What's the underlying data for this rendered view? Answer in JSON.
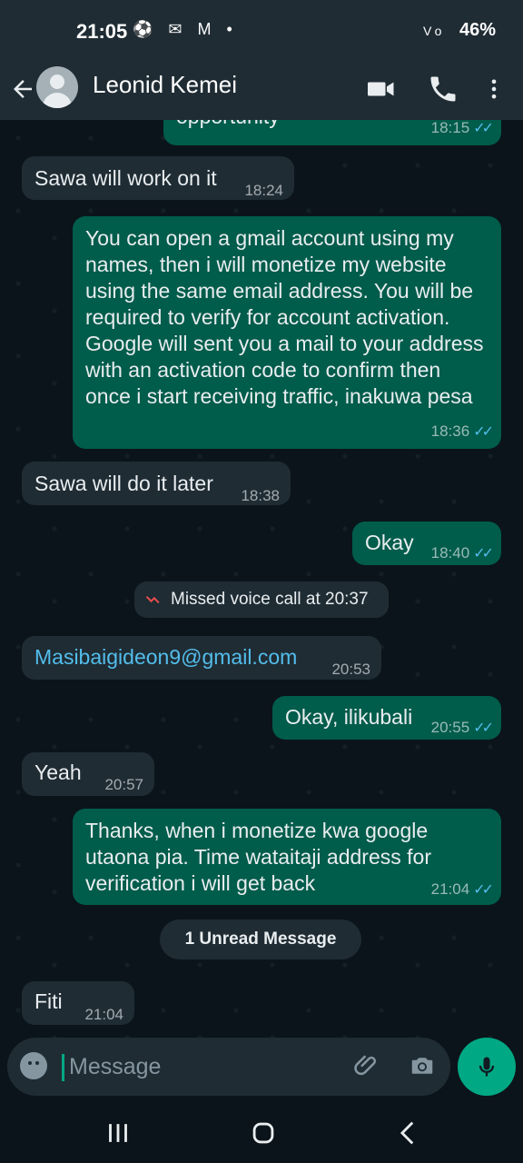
{
  "status_bar": {
    "time": "21:05",
    "left_icons": "⚽ ✉ M •",
    "signal_label": "Vo",
    "battery": "46%"
  },
  "header": {
    "contact_name": "Leonid Kemei",
    "icons": [
      "back-arrow-icon",
      "avatar",
      "video-call-icon",
      "voice-call-icon",
      "more-options-icon"
    ]
  },
  "messages": [
    {
      "type": "out",
      "text": "opportunity",
      "time": "18:15",
      "ticks": "✓✓"
    },
    {
      "type": "in",
      "text": "Sawa will work on it",
      "time": "18:24"
    },
    {
      "type": "out",
      "text": "You can open a gmail account using my names, then i will monetize my website using the same email address. You will be required to verify for account activation. Google will sent you a mail to your address with an activation code to confirm then once i start receiving traffic, inakuwa pesa",
      "time": "18:36",
      "ticks": "✓✓"
    },
    {
      "type": "in",
      "text": "Sawa will do it later",
      "time": "18:38"
    },
    {
      "type": "out",
      "text": "Okay",
      "time": "18:40",
      "ticks": "✓✓"
    },
    {
      "type": "system",
      "text": "Missed voice call at 20:37"
    },
    {
      "type": "in",
      "text": "Masibaigideon9@gmail.com",
      "time": "20:53"
    },
    {
      "type": "out",
      "text": "Okay, ilikubali",
      "time": "20:55",
      "ticks": "✓✓"
    },
    {
      "type": "in",
      "text": "Yeah",
      "time": "20:57"
    },
    {
      "type": "out",
      "text": "Thanks, when i monetize kwa google utaona pia. Time wataitaji address for verification i will get back",
      "time": "21:04",
      "ticks": "✓✓"
    },
    {
      "type": "divider",
      "text": "1 Unread Message"
    },
    {
      "type": "in",
      "text": "Fiti",
      "time": "21:04"
    }
  ],
  "composer": {
    "placeholder": "Message"
  },
  "colors": {
    "background": "#0b141a",
    "incoming": "#1f2c34",
    "outgoing": "#005c4b",
    "accent": "#00a884",
    "link": "#53bdeb"
  }
}
